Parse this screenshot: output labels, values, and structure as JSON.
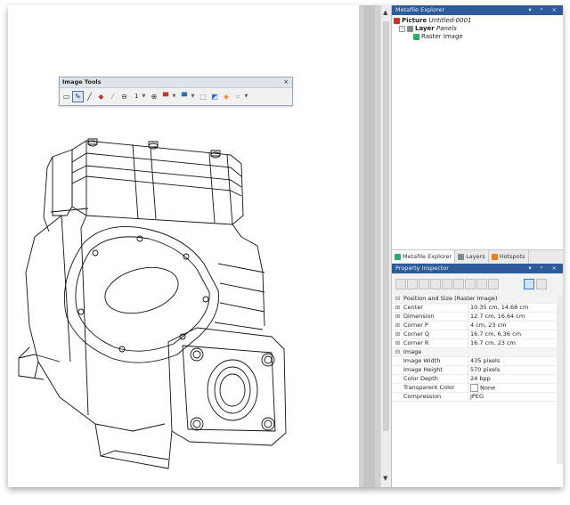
{
  "image_tools": {
    "title": "Image Tools",
    "close": "×",
    "size_value": "1",
    "icons": [
      "select-rectangle-icon",
      "pencil-icon",
      "line-icon",
      "eraser-icon",
      "color-picker-icon",
      "minus-circle-icon",
      "size-dropdown-icon",
      "plus-circle-icon",
      "fill-color-icon",
      "line-color-icon",
      "selection-icon",
      "flip-icon",
      "rotate-icon",
      "crop-icon"
    ]
  },
  "metafile_explorer": {
    "title": "Metafile Explorer",
    "controls": "▾ ᵖ ×",
    "tree": {
      "picture_label": "Picture",
      "picture_name": "Untitled-0001",
      "layer_label": "Layer",
      "layer_name": "Panels",
      "raster_label": "Raster Image"
    },
    "tabs": [
      "Metafile Explorer",
      "Layers",
      "Hotspots"
    ]
  },
  "property_inspector": {
    "title": "Property Inspector",
    "controls": "▾ ᵖ ×",
    "groups": [
      {
        "name": "Position and Size (Raster Image)",
        "rows": [
          {
            "key": "Center",
            "value": "10.35 cm, 14.68 cm"
          },
          {
            "key": "Dimension",
            "value": "12.7 cm, 16.64 cm"
          },
          {
            "key": "Corner P",
            "value": "4 cm, 23 cm"
          },
          {
            "key": "Corner Q",
            "value": "16.7 cm, 6.36 cm"
          },
          {
            "key": "Corner R",
            "value": "16.7 cm, 23 cm"
          }
        ]
      },
      {
        "name": "Image",
        "rows": [
          {
            "key": "Image Width",
            "value": "435 pixels"
          },
          {
            "key": "Image Height",
            "value": "570 pixels"
          },
          {
            "key": "Color Depth",
            "value": "24 bpp"
          },
          {
            "key": "Transparent Color",
            "value": "None"
          },
          {
            "key": "Compression",
            "value": "JPEG"
          }
        ]
      }
    ]
  },
  "colors": {
    "panel_title": "#2e5c9a",
    "selected_tool": "#3c78c8"
  }
}
